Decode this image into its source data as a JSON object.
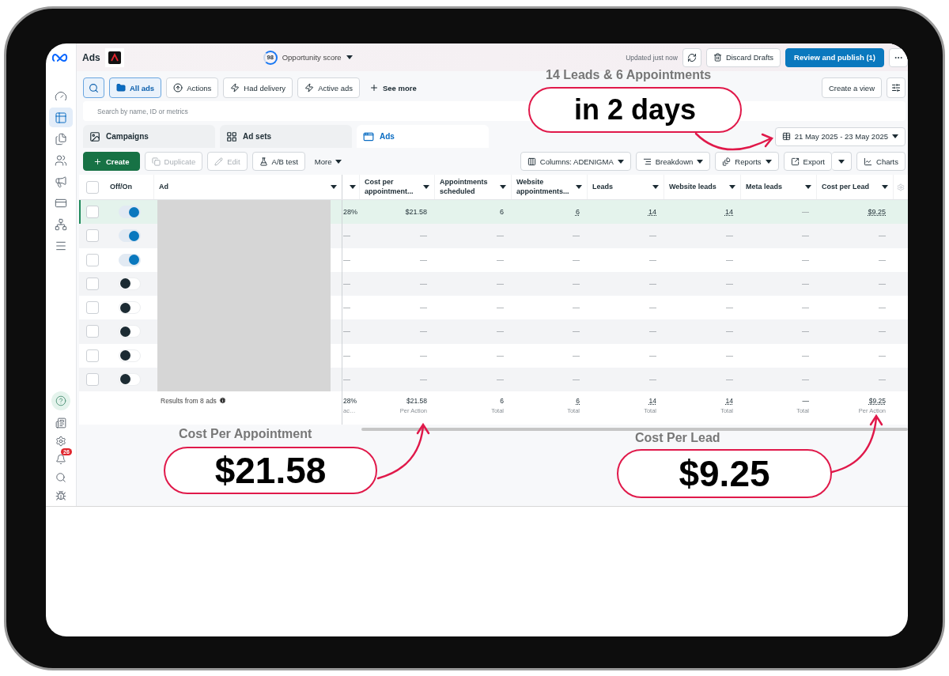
{
  "sidebar": {
    "nav_items": [
      {
        "selected": false
      },
      {
        "selected": true
      },
      {
        "selected": false
      },
      {
        "selected": false
      },
      {
        "selected": false
      },
      {
        "selected": false
      },
      {
        "selected": false
      },
      {
        "selected": false
      }
    ],
    "notification_count": "26"
  },
  "header": {
    "title": "Ads",
    "opportunity": {
      "score": "98",
      "label": "Opportunity score"
    },
    "status": "Updated just now",
    "discard": "Discard Drafts",
    "publish": "Review and publish (1)"
  },
  "filters": {
    "items": [
      {
        "label": "All ads",
        "selected": true
      },
      {
        "label": "Actions",
        "selected": false
      },
      {
        "label": "Had delivery",
        "selected": false
      },
      {
        "label": "Active ads",
        "selected": false
      }
    ],
    "see_more": "See more",
    "create_view": "Create a view"
  },
  "search": {
    "placeholder": "Search by name, ID or metrics"
  },
  "level_tabs": [
    {
      "label": "Campaigns",
      "selected": false
    },
    {
      "label": "Ad sets",
      "selected": false
    },
    {
      "label": "Ads",
      "selected": true
    }
  ],
  "date_range": "21 May 2025 - 23 May 2025",
  "toolbar": {
    "create": "Create",
    "actions": [
      {
        "label": "Duplicate",
        "disabled": true
      },
      {
        "label": "Edit",
        "disabled": true
      },
      {
        "label": "A/B test",
        "disabled": false
      }
    ],
    "more": "More",
    "right": [
      {
        "label": "Columns: ADENIGMA"
      },
      {
        "label": "Breakdown"
      },
      {
        "label": "Reports"
      }
    ],
    "export": "Export",
    "charts": "Charts"
  },
  "table": {
    "columns": [
      {
        "label": "Off/On"
      },
      {
        "label": "Ad"
      },
      {
        "label": "Cost per appointment...",
        "underlined": false
      },
      {
        "label": "Appointments scheduled",
        "underlined": false
      },
      {
        "label": "Website appointments...",
        "underlined": true
      },
      {
        "label": "Leads",
        "underlined": true
      },
      {
        "label": "Website leads",
        "underlined": true
      },
      {
        "label": "Meta leads"
      },
      {
        "label": "Cost per Lead",
        "underlined": true
      }
    ],
    "all_checked": false,
    "rows": [
      {
        "checked": false,
        "on": true,
        "highlighted": true,
        "cells": [
          "28%",
          "$21.58",
          "6",
          "6",
          "14",
          "14",
          "—",
          "$9.25"
        ]
      },
      {
        "checked": false,
        "on": true,
        "highlighted": false,
        "cells": [
          "—",
          "—",
          "—",
          "—",
          "—",
          "—",
          "—",
          "—"
        ]
      },
      {
        "checked": false,
        "on": true,
        "highlighted": false,
        "cells": [
          "—",
          "—",
          "—",
          "—",
          "—",
          "—",
          "—",
          "—"
        ]
      },
      {
        "checked": false,
        "on": false,
        "highlighted": false,
        "cells": [
          "—",
          "—",
          "—",
          "—",
          "—",
          "—",
          "—",
          "—"
        ]
      },
      {
        "checked": false,
        "on": false,
        "highlighted": false,
        "cells": [
          "—",
          "—",
          "—",
          "—",
          "—",
          "—",
          "—",
          "—"
        ]
      },
      {
        "checked": false,
        "on": false,
        "highlighted": false,
        "cells": [
          "—",
          "—",
          "—",
          "—",
          "—",
          "—",
          "—",
          "—"
        ]
      },
      {
        "checked": false,
        "on": false,
        "highlighted": false,
        "cells": [
          "—",
          "—",
          "—",
          "—",
          "—",
          "—",
          "—",
          "—"
        ]
      },
      {
        "checked": false,
        "on": false,
        "highlighted": false,
        "cells": [
          "—",
          "—",
          "—",
          "—",
          "—",
          "—",
          "—",
          "—"
        ]
      }
    ],
    "summary": {
      "label": "Results from 8 ads",
      "cells": [
        {
          "value": "28%",
          "sub": "ac…"
        },
        {
          "value": "$21.58",
          "sub": "Per Action"
        },
        {
          "value": "6",
          "sub": "Total"
        },
        {
          "value": "6",
          "sub": "Total"
        },
        {
          "value": "14",
          "sub": "Total"
        },
        {
          "value": "14",
          "sub": "Total"
        },
        {
          "value": "—",
          "sub": "Total"
        },
        {
          "value": "$9.25",
          "sub": "Per Action"
        }
      ]
    }
  },
  "annotations": {
    "headline": "14 Leads & 6 Appointments",
    "days": "in 2 days",
    "appointment": {
      "title": "Cost Per Appointment",
      "value": "$21.58"
    },
    "lead": {
      "title": "Cost Per Lead",
      "value": "$9.25"
    }
  }
}
